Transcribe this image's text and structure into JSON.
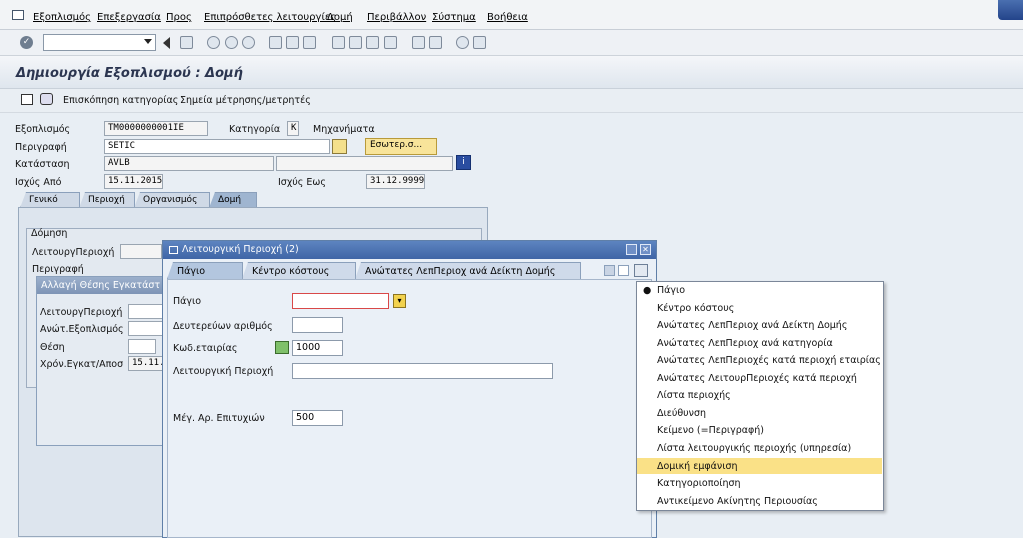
{
  "menu": {
    "items": [
      "Εξοπλισμός",
      "Επεξεργασία",
      "Προς",
      "Επιπρόσθετες λειτουργίες",
      "Δομή",
      "Περιβάλλον",
      "Σύστημα",
      "Βοήθεια"
    ]
  },
  "page": {
    "title": "Δημιουργία Εξοπλισμού : Δομή"
  },
  "app_toolbar": {
    "overview": "Επισκόπηση κατηγορίας",
    "points": "Σημεία μέτρησης/μετρητές"
  },
  "header": {
    "equipment_label": "Εξοπλισμός",
    "equipment_value": "TM0000000001IE",
    "category_label": "Κατηγορία",
    "category_value": "K",
    "category_text": "Μηχανήματα",
    "description_label": "Περιγραφή",
    "description_value": "SETIC",
    "internal_button": "Εσωτερ.σ...",
    "status_label": "Κατάσταση",
    "status_value": "AVLB",
    "valid_from_label": "Ισχύς Από",
    "valid_from_value": "15.11.2015",
    "valid_to_label": "Ισχύς Εως",
    "valid_to_value": "31.12.9999"
  },
  "tabs": [
    "Γενικό",
    "Περιοχή",
    "Οργανισμός",
    "Δομή"
  ],
  "structure": {
    "frame_title": "Δόμηση",
    "func_loc_label": "ΛειτουργΠεριοχή",
    "description_label": "Περιγραφή"
  },
  "sub_dialog": {
    "title": "Αλλαγή Θέσης Εγκατάστ",
    "func_loc_label": "ΛειτουργΠεριοχή",
    "parent_label": "Ανώτ.Εξοπλισμός",
    "position_label": "Θέση",
    "time_label": "Χρόν.Εγκατ/Αποσ",
    "time_value": "15.11."
  },
  "dialog": {
    "title": "Λειτουργική Περιοχή (2)",
    "tabs": [
      "Πάγιο",
      "Κέντρο κόστους",
      "Ανώτατες ΛεπΠεριοχ ανά Δείκτη Δομής"
    ],
    "fields": {
      "asset_label": "Πάγιο",
      "asset_value": "",
      "secondary_label": "Δευτερεύων αριθμός",
      "secondary_value": "",
      "company_label": "Κωδ.εταιρίας",
      "company_value": "1000",
      "func_area_label": "Λειτουργική Περιοχή",
      "func_area_value": "",
      "max_hits_label": "Μέγ. Αρ. Επιτυχιών",
      "max_hits_value": "500"
    }
  },
  "dropdown": {
    "items": [
      "Πάγιο",
      "Κέντρο κόστους",
      "Ανώτατες ΛεπΠεριοχ ανά Δείκτη Δομής",
      "Ανώτατες ΛεπΠεριοχ ανά κατηγορία",
      "Ανώτατες ΛεπΠεριοχές κατά περιοχή εταιρίας",
      "Ανώτατες ΛειτουρΠεριοχές κατά περιοχή",
      "Λίστα περιοχής",
      "Διεύθυνση",
      "Κείμενο (=Περιγραφή)",
      "Λίστα λειτουργικής περιοχής (υπηρεσία)",
      "Δομική εμφάνιση",
      "Κατηγοριοποίηση",
      "Αντικείμενο Ακίνητης Περιουσίας"
    ],
    "selected": "Δομική εμφάνιση",
    "bullet": "●"
  },
  "colors": {
    "accent": "#3f65a6",
    "highlight": "#fae187"
  }
}
